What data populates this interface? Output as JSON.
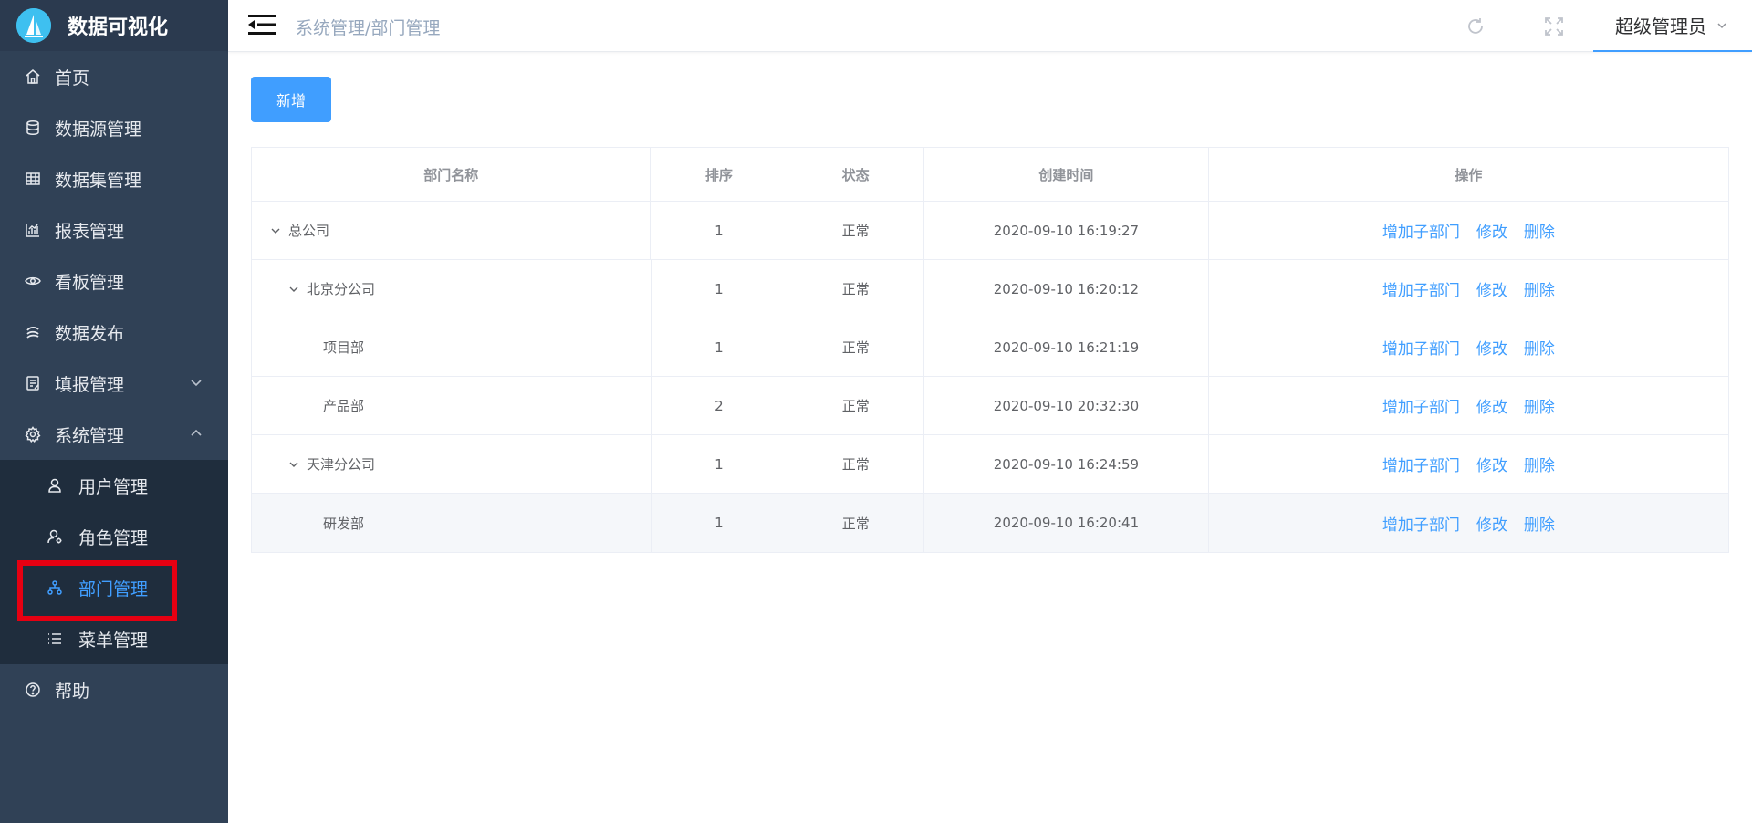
{
  "app": {
    "title": "数据可视化"
  },
  "sidebar": {
    "items": [
      {
        "label": "首页",
        "icon": "home-icon"
      },
      {
        "label": "数据源管理",
        "icon": "database-icon"
      },
      {
        "label": "数据集管理",
        "icon": "table-icon"
      },
      {
        "label": "报表管理",
        "icon": "chart-icon"
      },
      {
        "label": "看板管理",
        "icon": "eye-icon"
      },
      {
        "label": "数据发布",
        "icon": "publish-icon"
      },
      {
        "label": "填报管理",
        "icon": "form-icon",
        "expanded": false
      },
      {
        "label": "系统管理",
        "icon": "gear-icon",
        "expanded": true
      }
    ],
    "sub_items": [
      {
        "label": "用户管理",
        "icon": "user-icon"
      },
      {
        "label": "角色管理",
        "icon": "role-icon"
      },
      {
        "label": "部门管理",
        "icon": "department-icon",
        "active": true
      },
      {
        "label": "菜单管理",
        "icon": "list-icon"
      }
    ],
    "help": {
      "label": "帮助",
      "icon": "help-icon"
    }
  },
  "header": {
    "breadcrumb": "系统管理/部门管理",
    "user": "超级管理员"
  },
  "toolbar": {
    "add_label": "新增"
  },
  "table": {
    "columns": [
      "部门名称",
      "排序",
      "状态",
      "创建时间",
      "操作"
    ],
    "rows": [
      {
        "name": "总公司",
        "level": 0,
        "expandable": true,
        "order": "1",
        "status": "正常",
        "created": "2020-09-10 16:19:27"
      },
      {
        "name": "北京分公司",
        "level": 1,
        "expandable": true,
        "order": "1",
        "status": "正常",
        "created": "2020-09-10 16:20:12"
      },
      {
        "name": "项目部",
        "level": 2,
        "expandable": false,
        "order": "1",
        "status": "正常",
        "created": "2020-09-10 16:21:19"
      },
      {
        "name": "产品部",
        "level": 2,
        "expandable": false,
        "order": "2",
        "status": "正常",
        "created": "2020-09-10 20:32:30"
      },
      {
        "name": "天津分公司",
        "level": 1,
        "expandable": true,
        "order": "1",
        "status": "正常",
        "created": "2020-09-10 16:24:59"
      },
      {
        "name": "研发部",
        "level": 2,
        "expandable": false,
        "order": "1",
        "status": "正常",
        "created": "2020-09-10 16:20:41",
        "hover": true
      }
    ],
    "actions": [
      "增加子部门",
      "修改",
      "删除"
    ]
  },
  "colors": {
    "sidebar_bg": "#304156",
    "accent": "#409eff",
    "highlight": "#e60012"
  }
}
